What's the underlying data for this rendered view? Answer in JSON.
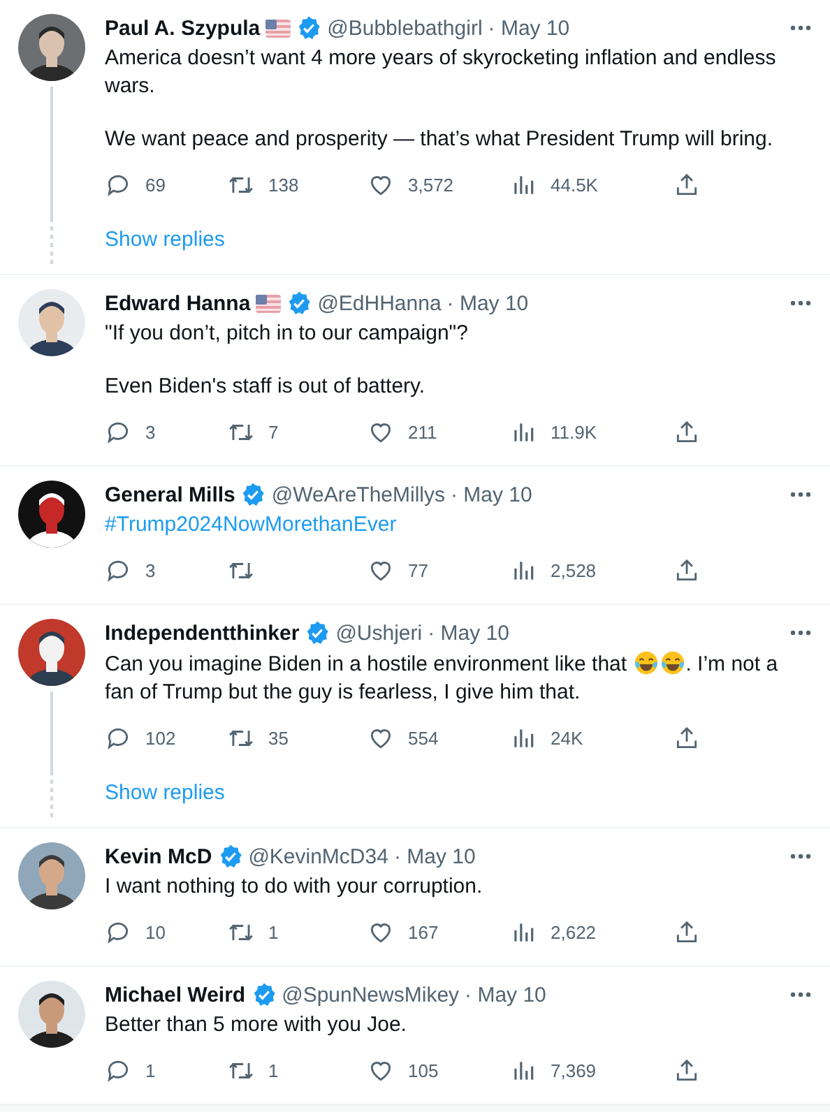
{
  "tweets": [
    {
      "name": "Paul A. Szypula",
      "flag": true,
      "verified": true,
      "handle": "@Bubblebathgirl",
      "date": "· May 10",
      "paragraphs": [
        [
          {
            "kind": "text",
            "text": "America doesn’t want 4 more years of skyrocketing inflation and endless wars."
          }
        ],
        [
          {
            "kind": "text",
            "text": "We want peace and prosperity — that’s what President Trump will bring."
          }
        ]
      ],
      "replies": "69",
      "retweets": "138",
      "likes": "3,572",
      "views": "44.5K",
      "show_replies": "Show replies"
    },
    {
      "name": "Edward Hanna",
      "flag": true,
      "verified": true,
      "handle": "@EdHHanna",
      "date": "· May 10",
      "paragraphs": [
        [
          {
            "kind": "text",
            "text": "\"If you don’t, pitch in to our campaign\"?"
          }
        ],
        [
          {
            "kind": "text",
            "text": "Even Biden's staff is out of battery."
          }
        ]
      ],
      "replies": "3",
      "retweets": "7",
      "likes": "211",
      "views": "11.9K"
    },
    {
      "name": "General Mills",
      "flag": false,
      "verified": true,
      "handle": "@WeAreTheMillys",
      "date": "· May 10",
      "paragraphs": [
        [
          {
            "kind": "hashtag",
            "text": "#Trump2024NowMorethanEver"
          }
        ]
      ],
      "replies": "3",
      "likes": "77",
      "views": "2,528"
    },
    {
      "name": "Independentthinker",
      "flag": false,
      "verified": true,
      "handle": "@Ushjeri",
      "date": "· May 10",
      "paragraphs": [
        [
          {
            "kind": "text",
            "text": "Can you imagine Biden in a hostile environment like that "
          },
          {
            "kind": "emoji"
          },
          {
            "kind": "emoji"
          },
          {
            "kind": "text",
            "text": ".  I’m not a fan of Trump but the guy is fearless, I give him that."
          }
        ]
      ],
      "replies": "102",
      "retweets": "35",
      "likes": "554",
      "views": "24K",
      "show_replies": "Show replies"
    },
    {
      "name": "Kevin McD",
      "flag": false,
      "verified": true,
      "handle": "@KevinMcD34",
      "date": "· May 10",
      "paragraphs": [
        [
          {
            "kind": "text",
            "text": "I want nothing to do with your corruption."
          }
        ]
      ],
      "replies": "10",
      "retweets": "1",
      "likes": "167",
      "views": "2,622"
    },
    {
      "name": "Michael Weird",
      "flag": false,
      "verified": true,
      "handle": "@SpunNewsMikey",
      "date": "· May 10",
      "paragraphs": [
        [
          {
            "kind": "text",
            "text": "Better than 5 more with you Joe."
          }
        ]
      ],
      "replies": "1",
      "retweets": "1",
      "likes": "105",
      "views": "7,369"
    }
  ]
}
